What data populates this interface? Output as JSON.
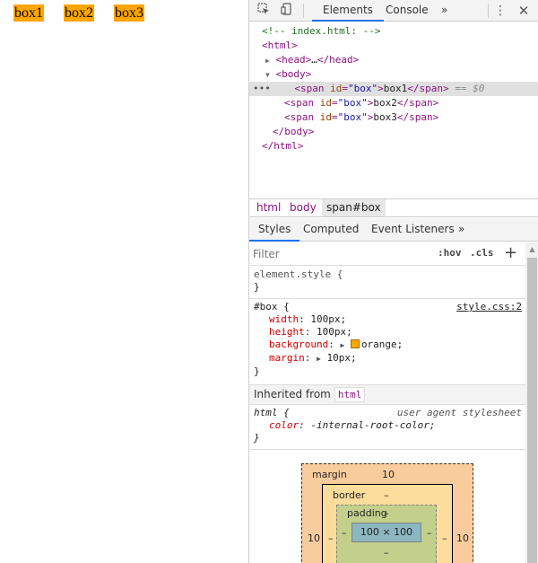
{
  "preview": {
    "boxes": [
      "box1",
      "box2",
      "box3"
    ]
  },
  "toolbar": {
    "tabs": [
      "Elements",
      "Console"
    ],
    "more": "»"
  },
  "dom": {
    "comment": "<!-- index.html: -->",
    "html_open": "<html>",
    "head_open": "<head>",
    "head_ellipsis": "…",
    "head_close": "</head>",
    "body_open": "<body>",
    "span_open": "<span",
    "attr_id": "id",
    "attr_eq": "=",
    "attr_id_value": "\"box\"",
    "span_close_bracket": ">",
    "span_close": "</span>",
    "rows": [
      "box1",
      "box2",
      "box3"
    ],
    "selected_suffix": "== $0",
    "row_marker": "•••",
    "body_close": "</body>",
    "html_close": "</html>"
  },
  "breadcrumbs": [
    "html",
    "body",
    "span#box"
  ],
  "subtabs": [
    "Styles",
    "Computed",
    "Event Listeners",
    "»"
  ],
  "filter": {
    "placeholder": "Filter",
    "hov": ":hov",
    "cls": ".cls",
    "plus": "+"
  },
  "styles": {
    "element_style": {
      "selector": "element.style {",
      "close": "}"
    },
    "box_rule": {
      "selector": "#box {",
      "source": "style.css:2",
      "props": [
        {
          "name": "width",
          "value": "100px;"
        },
        {
          "name": "height",
          "value": "100px;"
        },
        {
          "name": "background",
          "value": "orange;"
        },
        {
          "name": "margin",
          "value": "10px;"
        }
      ],
      "close": "}"
    },
    "inherited_label": "Inherited from",
    "inherited_tag": "html",
    "html_rule": {
      "selector": "html {",
      "source": "user agent stylesheet",
      "props": [
        {
          "name": "color",
          "value": "-internal-root-color;"
        }
      ],
      "close": "}"
    }
  },
  "box_model": {
    "margin_label": "margin",
    "margin_value": "10",
    "margin_left": "10",
    "margin_right": "10",
    "border_label": "border",
    "border_value": "–",
    "border_left": "–",
    "border_right": "–",
    "padding_label": "padding",
    "padding_value": "–",
    "padding_left": "–",
    "padding_right": "–",
    "padding_bottom": "–",
    "content": "100 × 100"
  },
  "colors": {
    "box_background": "#ffa500",
    "accent": "#1a73e8"
  }
}
